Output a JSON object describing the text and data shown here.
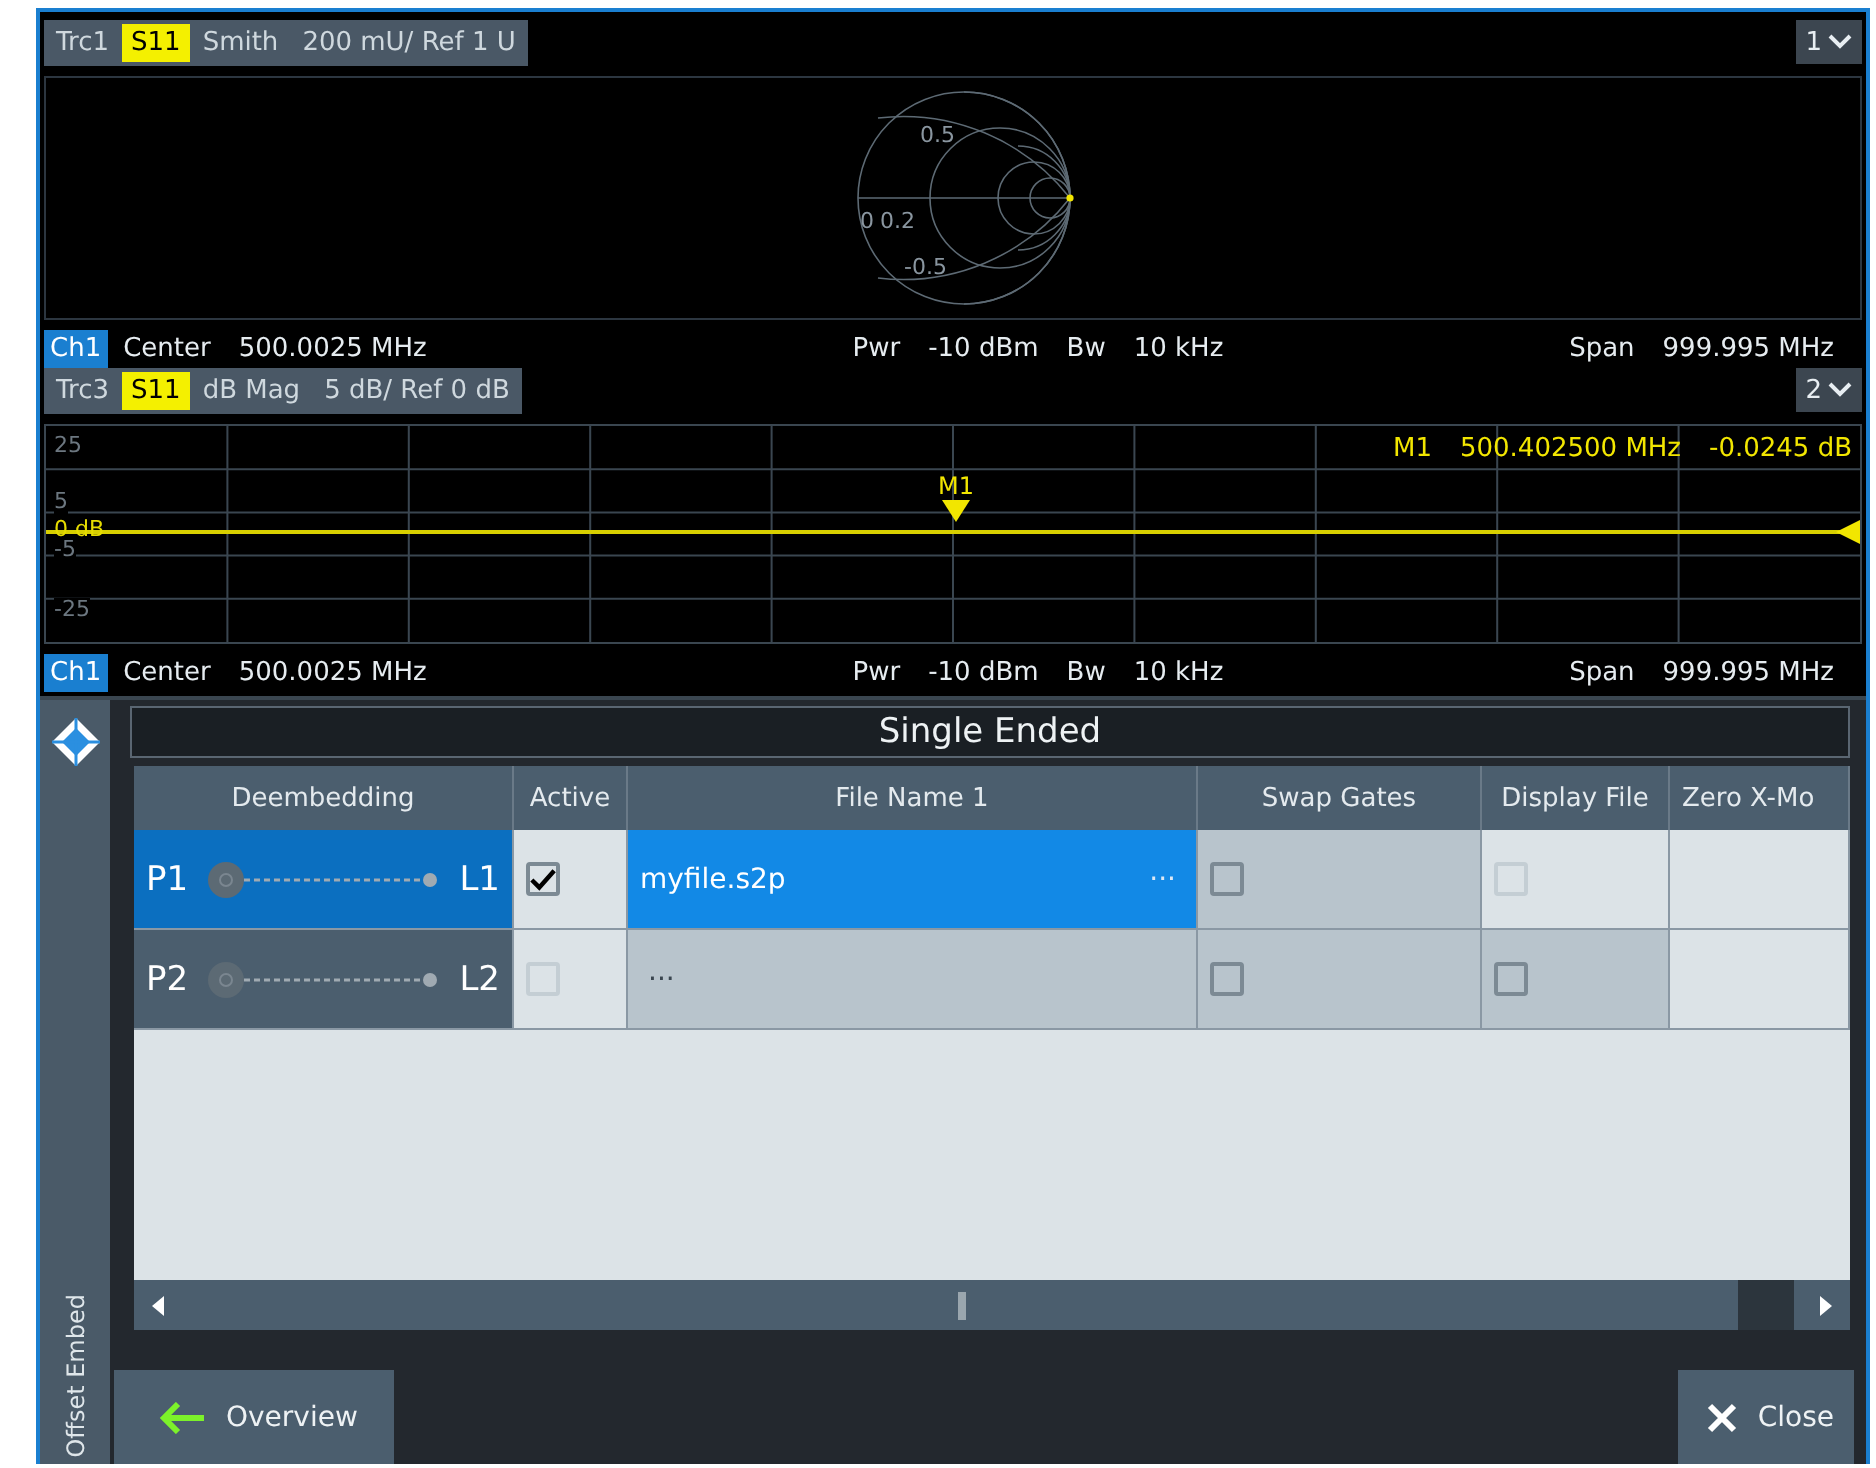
{
  "diagrams": [
    {
      "kind": "smith",
      "trace": "Trc1",
      "parameter": "S11",
      "format": "Smith",
      "scale": "200 mU/ Ref 1 U",
      "number": "1",
      "labels": [
        "0.5",
        "0",
        "0.2",
        "-0.5"
      ],
      "channel": {
        "name": "Ch1",
        "center_label": "Center",
        "center": "500.0025 MHz",
        "pwr_label": "Pwr",
        "pwr": "-10 dBm",
        "bw_label": "Bw",
        "bw": "10 kHz",
        "span_label": "Span",
        "span": "999.995 MHz"
      }
    },
    {
      "kind": "cartesian",
      "trace": "Trc3",
      "parameter": "S11",
      "format": "dB Mag",
      "scale": "5 dB/ Ref 0 dB",
      "number": "2",
      "y_labels": [
        "25",
        "5",
        "-5",
        "-25"
      ],
      "ref_label": "0 dB",
      "marker": {
        "name": "M1",
        "readout_name": "M1",
        "frequency": "500.402500 MHz",
        "value": "-0.0245 dB"
      },
      "channel": {
        "name": "Ch1",
        "center_label": "Center",
        "center": "500.0025 MHz",
        "pwr_label": "Pwr",
        "pwr": "-10 dBm",
        "bw_label": "Bw",
        "bw": "10 kHz",
        "span_label": "Span",
        "span": "999.995 MHz"
      }
    }
  ],
  "panel": {
    "side_label": "Offset Embed",
    "title": "Single Ended",
    "table": {
      "columns": [
        "Deembedding",
        "Active",
        "File Name 1",
        "Swap Gates",
        "Display File",
        "Zero X-Mo"
      ],
      "rows": [
        {
          "port": "P1",
          "line": "L1",
          "selected": true,
          "active": {
            "checked": true,
            "disabled": false
          },
          "file": "myfile.s2p",
          "browse": "···",
          "swap_gates": {
            "checked": false,
            "disabled": false
          },
          "display_file": {
            "checked": false,
            "disabled": true
          }
        },
        {
          "port": "P2",
          "line": "L2",
          "selected": false,
          "active": {
            "checked": false,
            "disabled": true
          },
          "browse": "···",
          "swap_gates": {
            "checked": false,
            "disabled": false
          },
          "display_file": {
            "checked": false,
            "disabled": false
          }
        }
      ]
    },
    "buttons": [
      {
        "kind": "back",
        "label": "Overview"
      },
      {
        "kind": "close",
        "label": "Close"
      }
    ]
  }
}
